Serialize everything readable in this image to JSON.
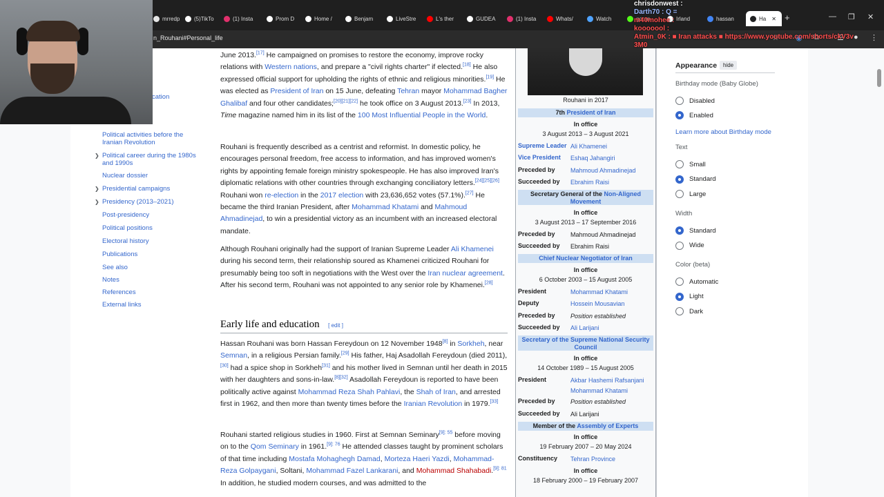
{
  "browser": {
    "tabs": [
      {
        "label": "mrredp",
        "color": "#e6e6e6"
      },
      {
        "label": "(5)TikTo",
        "color": "#ffffff"
      },
      {
        "label": "(1) Insta",
        "color": "#e1306c"
      },
      {
        "label": "Prom D",
        "color": "#ffffff"
      },
      {
        "label": "Home /",
        "color": "#ffffff"
      },
      {
        "label": "Benjam",
        "color": "#ffffff"
      },
      {
        "label": "LiveStre",
        "color": "#ffffff"
      },
      {
        "label": "L's ther",
        "color": "#ff0000"
      },
      {
        "label": "GUDEA",
        "color": "#ffffff"
      },
      {
        "label": "(1) Insta",
        "color": "#e1306c"
      },
      {
        "label": "Whats/",
        "color": "#ff0000"
      },
      {
        "label": "Watch",
        "color": "#4fa3ff"
      },
      {
        "label": "goran",
        "color": "#53fc18"
      },
      {
        "label": "Irland",
        "color": "#ffffff"
      },
      {
        "label": "hassan",
        "color": "#4285f4"
      },
      {
        "label": "Ha",
        "color": "#202122"
      }
    ],
    "url": "n_Rouhani#Personal_life",
    "new_tab": "+",
    "minimize": "—",
    "restore": "❐",
    "close": "✕",
    "tab_close": "✕"
  },
  "chat": [
    {
      "text": "chrisdonwest :",
      "color": "#ffffff"
    },
    {
      "text": "Darth70 : Q =",
      "color": "#9ab8ff"
    },
    {
      "text": "m40mohee :",
      "color": "#ff4d4d"
    },
    {
      "text": "kooooool :",
      "color": "#ff4d4d"
    },
    {
      "text": "Atmin_0K : ■ Iran attacks ■ https://www.youtube.com/shorts/ckV3v",
      "color": "#ff4d4d"
    },
    {
      "text": "3M0",
      "color": "#ff4d4d"
    }
  ],
  "toc": {
    "top_item": "cation",
    "items": [
      {
        "label": "Political activities before the Iranian Revolution",
        "arrow": false
      },
      {
        "label": "Political career during the 1980s and 1990s",
        "arrow": true
      },
      {
        "label": "Nuclear dossier",
        "arrow": false
      },
      {
        "label": "Presidential campaigns",
        "arrow": true
      },
      {
        "label": "Presidency (2013–2021)",
        "arrow": true
      },
      {
        "label": "Post-presidency",
        "arrow": false
      },
      {
        "label": "Political positions",
        "arrow": false
      },
      {
        "label": "Electoral history",
        "arrow": false
      },
      {
        "label": "Publications",
        "arrow": false
      },
      {
        "label": "See also",
        "arrow": false
      },
      {
        "label": "Notes",
        "arrow": false
      },
      {
        "label": "References",
        "arrow": false
      },
      {
        "label": "External links",
        "arrow": false
      }
    ],
    "arrow_glyph": "❯"
  },
  "article": {
    "heading": "Early life and education",
    "edit": "edit"
  },
  "infobox": {
    "caption": "Rouhani in 2017",
    "office1": {
      "pre": "7th ",
      "title": "President of Iran",
      "in_office": "In office",
      "dates": "3 August 2013 – 3 August 2021",
      "rows": [
        {
          "label": "Supreme Leader",
          "value": "Ali Khamenei"
        },
        {
          "label": "Vice President",
          "value": "Eshaq Jahangiri"
        },
        {
          "label": "Preceded by",
          "value": "Mahmoud Ahmadinejad"
        },
        {
          "label": "Succeeded by",
          "value": "Ebrahim Raisi"
        }
      ]
    },
    "office2": {
      "pre": "Secretary General of the ",
      "title": "Non-Aligned Movement",
      "in_office": "In office",
      "dates": "3 August 2013 – 17 September 2016",
      "rows": [
        {
          "label": "Preceded by",
          "value": "Mahmoud Ahmadinejad"
        },
        {
          "label": "Succeeded by",
          "value": "Ebrahim Raisi"
        }
      ]
    },
    "office3": {
      "title": "Chief Nuclear Negotiator of Iran",
      "in_office": "In office",
      "dates": "6 October 2003 – 15 August 2005",
      "rows": [
        {
          "label": "President",
          "value": "Mohammad Khatami"
        },
        {
          "label": "Deputy",
          "value": "Hossein Mousavian"
        },
        {
          "label": "Preceded by",
          "value": "Position established"
        },
        {
          "label": "Succeeded by",
          "value": "Ali Larijani"
        }
      ]
    },
    "office4": {
      "title": "Secretary of the Supreme National Security Council",
      "in_office": "In office",
      "dates": "14 October 1989 – 15 August 2005",
      "rows": [
        {
          "label": "President",
          "value": "Akbar Hashemi Rafsanjani",
          "value2": "Mohammad Khatami"
        },
        {
          "label": "Preceded by",
          "value": "Position established"
        },
        {
          "label": "Succeeded by",
          "value": "Ali Larijani"
        }
      ]
    },
    "office5": {
      "pre": "Member of the ",
      "title": "Assembly of Experts",
      "in_office": "In office",
      "dates": "19 February 2007 – 20 May 2024",
      "rows": [
        {
          "label": "Constituency",
          "value": "Tehran Province"
        }
      ]
    },
    "office6": {
      "in_office": "In office",
      "dates": "18 February 2000 – 19 February 2007"
    }
  },
  "appearance": {
    "title": "Appearance",
    "hide": "hide",
    "birthday_label": "Birthday mode (Baby Globe)",
    "birthday_options": [
      "Disabled",
      "Enabled"
    ],
    "birthday_selected": "Enabled",
    "birthday_link": "Learn more about Birthday mode",
    "text_label": "Text",
    "text_options": [
      "Small",
      "Standard",
      "Large"
    ],
    "text_selected": "Standard",
    "width_label": "Width",
    "width_options": [
      "Standard",
      "Wide"
    ],
    "width_selected": "Standard",
    "color_label": "Color (beta)",
    "color_options": [
      "Automatic",
      "Light",
      "Dark"
    ],
    "color_selected": "Light"
  }
}
